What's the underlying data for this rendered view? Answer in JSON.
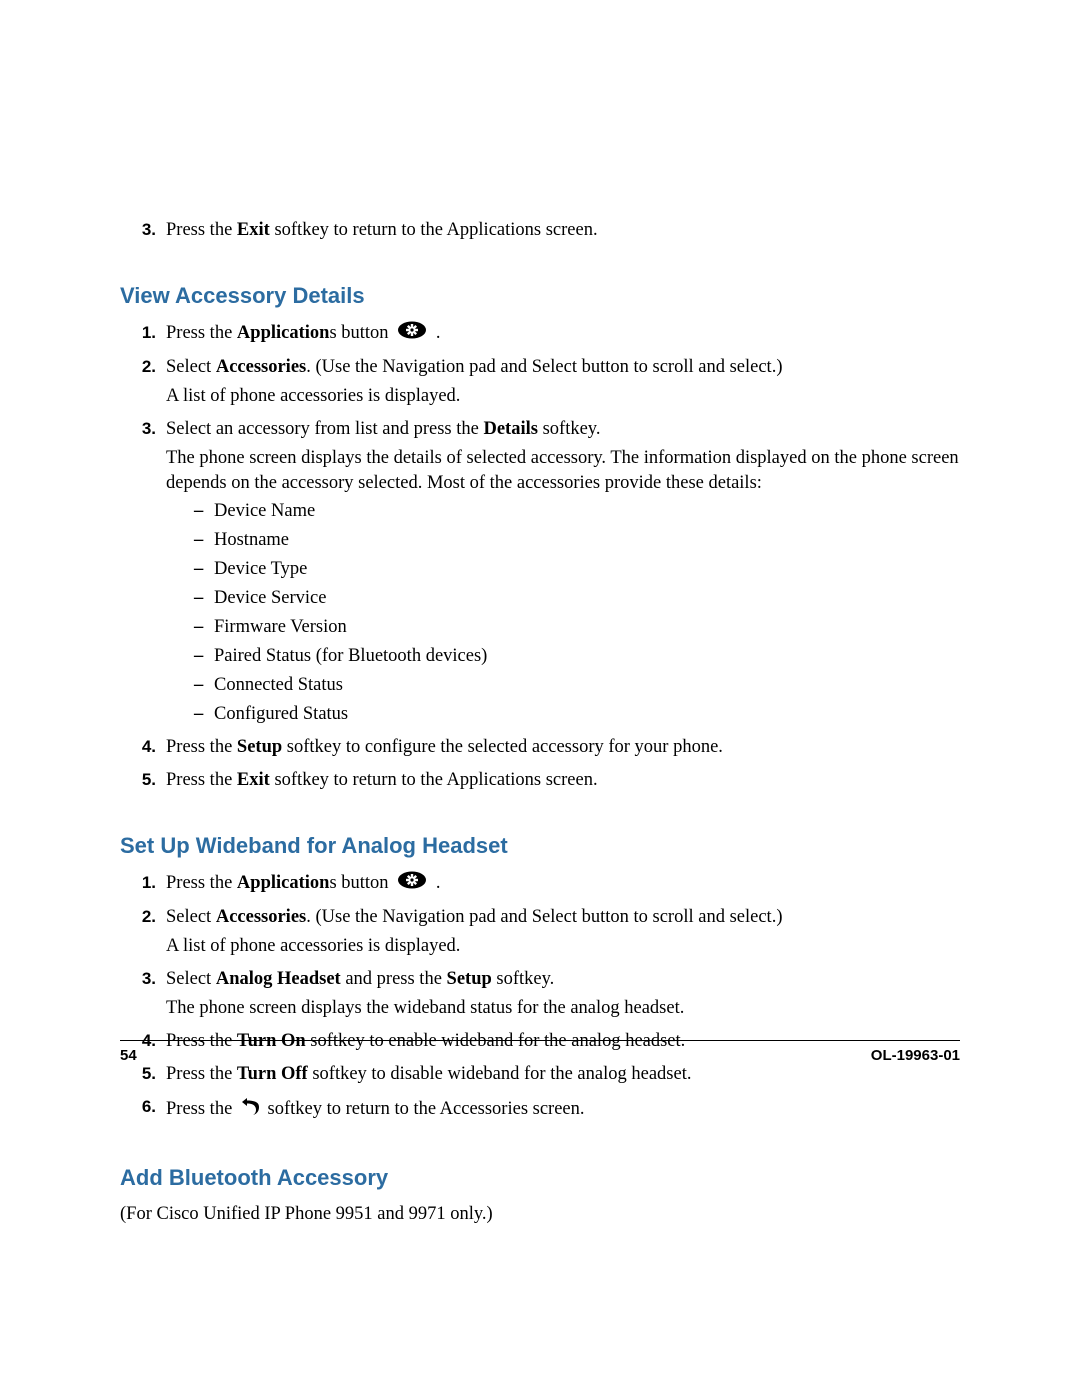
{
  "top_step": {
    "num": "3.",
    "text_before": "Press the ",
    "bold1": "Exit",
    "text_after": " softkey to return to the Applications screen."
  },
  "section1": {
    "heading": "View Accessory Details",
    "steps": {
      "s1": {
        "num": "1.",
        "a": "Press the ",
        "b": "Application",
        "c": "s button",
        "d": " ."
      },
      "s2": {
        "num": "2.",
        "a": "Select ",
        "b": "Accessories",
        "c": ". (Use the Navigation pad and Select button to scroll and select.)",
        "p2": "A list of phone accessories is displayed."
      },
      "s3": {
        "num": "3.",
        "a": "Select an accessory from list and press the ",
        "b": "Details",
        "c": " softkey.",
        "p2": "The phone screen displays the details of selected accessory. The information displayed on the phone screen depends on the accessory selected. Most of the accessories provide these details:",
        "items": {
          "i1": "Device Name",
          "i2": "Hostname",
          "i3": "Device Type",
          "i4": "Device Service",
          "i5": "Firmware Version",
          "i6": "Paired Status (for Bluetooth devices)",
          "i7": "Connected Status",
          "i8": "Configured Status"
        }
      },
      "s4": {
        "num": "4.",
        "a": "Press the ",
        "b": "Setup",
        "c": " softkey to configure the selected accessory for your phone."
      },
      "s5": {
        "num": "5.",
        "a": "Press the ",
        "b": "Exit",
        "c": " softkey to return to the Applications screen."
      }
    }
  },
  "section2": {
    "heading": "Set Up Wideband for Analog Headset",
    "steps": {
      "s1": {
        "num": "1.",
        "a": "Press the ",
        "b": "Application",
        "c": "s button",
        "d": " ."
      },
      "s2": {
        "num": "2.",
        "a": "Select ",
        "b": "Accessories",
        "c": ". (Use the Navigation pad and Select button to scroll and select.)",
        "p2": "A list of phone accessories is displayed."
      },
      "s3": {
        "num": "3.",
        "a": "Select ",
        "b": "Analog Headset",
        "c": " and press the ",
        "d": "Setup",
        "e": " softkey.",
        "p2": "The phone screen displays the wideband status for the analog headset."
      },
      "s4": {
        "num": "4.",
        "a": "Press the ",
        "b": "Turn On",
        "c": " softkey to enable wideband for the analog headset."
      },
      "s5": {
        "num": "5.",
        "a": "Press the ",
        "b": "Turn Off",
        "c": " softkey to disable wideband for the analog headset."
      },
      "s6": {
        "num": "6.",
        "a": "Press the ",
        "b": " softkey to return to the Accessories screen."
      }
    }
  },
  "section3": {
    "heading": "Add Bluetooth Accessory",
    "note": "(For Cisco Unified IP Phone 9951 and 9971 only.)"
  },
  "footer": {
    "page": "54",
    "docid": "OL-19963-01"
  }
}
